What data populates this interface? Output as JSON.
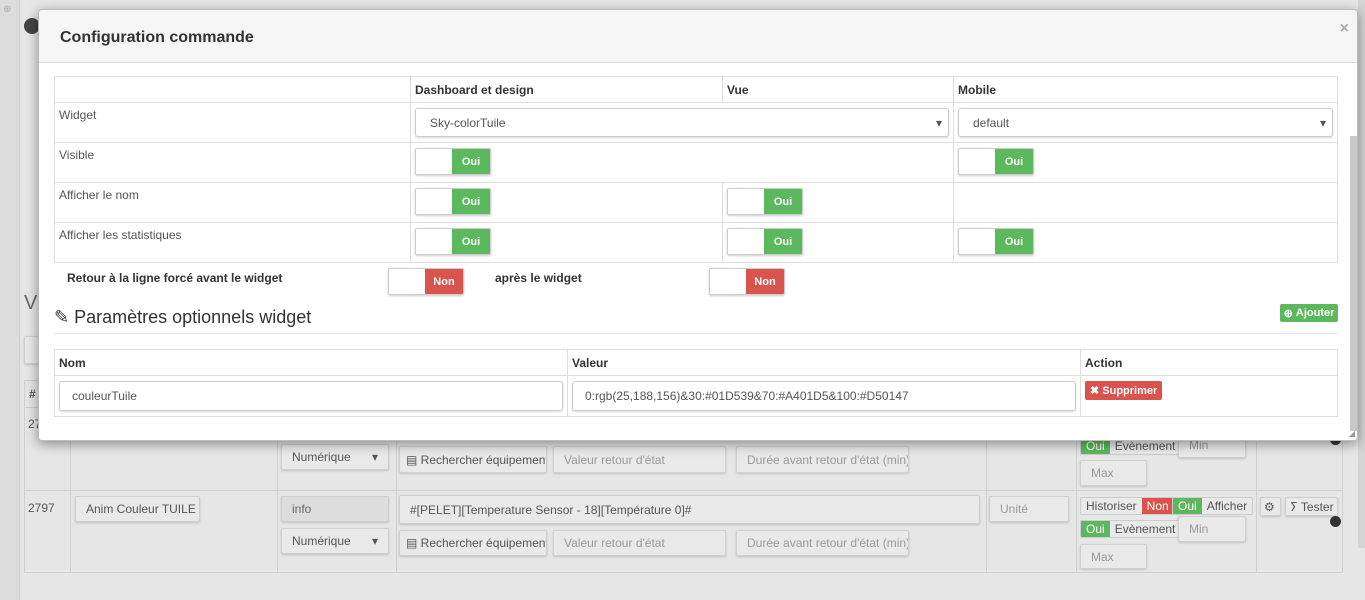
{
  "background": {
    "section_title_partial": "Vi",
    "table_header_partial": "#",
    "rows": [
      {
        "id": "27",
        "subtype": "Numérique",
        "search_btn": "Rechercher équipement",
        "return_value_placeholder": "Valeur retour d'état",
        "duration_placeholder": "Durée avant retour d'état (min)",
        "event_on": "Oui",
        "event_label": "Evènement",
        "min_placeholder": "Min",
        "max_placeholder": "Max"
      },
      {
        "id": "2797",
        "name": "Anim Couleur TUILE",
        "type": "info",
        "subtype": "Numérique",
        "command": "#[PELET][Temperature Sensor - 18][Température 0]#",
        "search_btn": "Rechercher équipement",
        "return_value_placeholder": "Valeur retour d'état",
        "duration_placeholder": "Durée avant retour d'état (min)",
        "unit_placeholder": "Unité",
        "historize_label": "Historiser",
        "historize_value": "Non",
        "display_on": "Oui",
        "display_label": "Afficher",
        "event_on": "Oui",
        "event_label": "Evènement",
        "min_placeholder": "Min",
        "max_placeholder": "Max",
        "test_btn": "Tester"
      }
    ]
  },
  "modal": {
    "title": "Configuration commande",
    "close": "×",
    "columns": [
      "",
      "Dashboard et design",
      "Vue",
      "Mobile"
    ],
    "rows": {
      "widget": {
        "label": "Widget",
        "dashboard": "Sky-colorTuile",
        "mobile": "default"
      },
      "visible": {
        "label": "Visible",
        "dashboard": "Oui",
        "mobile": "Oui"
      },
      "show_name": {
        "label": "Afficher le nom",
        "dashboard": "Oui",
        "vue": "Oui"
      },
      "show_stats": {
        "label": "Afficher les statistiques",
        "dashboard": "Oui",
        "vue": "Oui",
        "mobile": "Oui"
      }
    },
    "line_break_before_label": "Retour à la ligne forcé avant le widget",
    "line_break_before": "Non",
    "line_break_after_label": "après le widget",
    "line_break_after": "Non",
    "params_title": "Paramètres optionnels widget",
    "add_btn": "Ajouter",
    "params_columns": [
      "Nom",
      "Valeur",
      "Action"
    ],
    "params": [
      {
        "name": "couleurTuile",
        "value": "0:rgb(25,188,156)&30:#01D539&70:#A401D5&100:#D50147",
        "action": "Supprimer"
      }
    ]
  },
  "colors": {
    "on": "#5cb85c",
    "off": "#d9534f"
  }
}
